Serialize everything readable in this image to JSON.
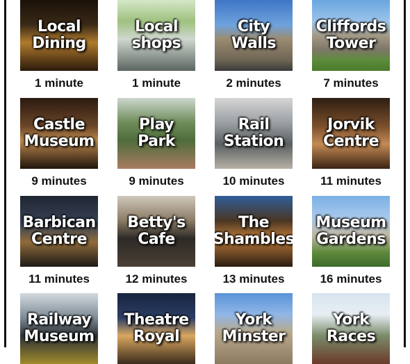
{
  "tiles": [
    {
      "title_l1": "Local",
      "title_l2": "Dining",
      "caption": "1 minute"
    },
    {
      "title_l1": "Local",
      "title_l2": "shops",
      "caption": "1 minute"
    },
    {
      "title_l1": "City",
      "title_l2": "Walls",
      "caption": "2 minutes"
    },
    {
      "title_l1": "Cliffords",
      "title_l2": "Tower",
      "caption": "7 minutes"
    },
    {
      "title_l1": "Castle",
      "title_l2": "Museum",
      "caption": "9 minutes"
    },
    {
      "title_l1": "Play",
      "title_l2": "Park",
      "caption": "9 minutes"
    },
    {
      "title_l1": "Rail",
      "title_l2": "Station",
      "caption": "10 minutes"
    },
    {
      "title_l1": "Jorvik",
      "title_l2": "Centre",
      "caption": "11 minutes"
    },
    {
      "title_l1": "Barbican",
      "title_l2": "Centre",
      "caption": "11 minutes"
    },
    {
      "title_l1": "Betty's",
      "title_l2": "Cafe",
      "caption": "12 minutes"
    },
    {
      "title_l1": "The",
      "title_l2": "Shambles",
      "caption": "13 minutes"
    },
    {
      "title_l1": "Museum",
      "title_l2": "Gardens",
      "caption": "16 minutes"
    },
    {
      "title_l1": "Railway",
      "title_l2": "Museum",
      "caption": ""
    },
    {
      "title_l1": "Theatre",
      "title_l2": "Royal",
      "caption": ""
    },
    {
      "title_l1": "York",
      "title_l2": "Minster",
      "caption": ""
    },
    {
      "title_l1": "York",
      "title_l2": "Races",
      "caption": ""
    }
  ]
}
